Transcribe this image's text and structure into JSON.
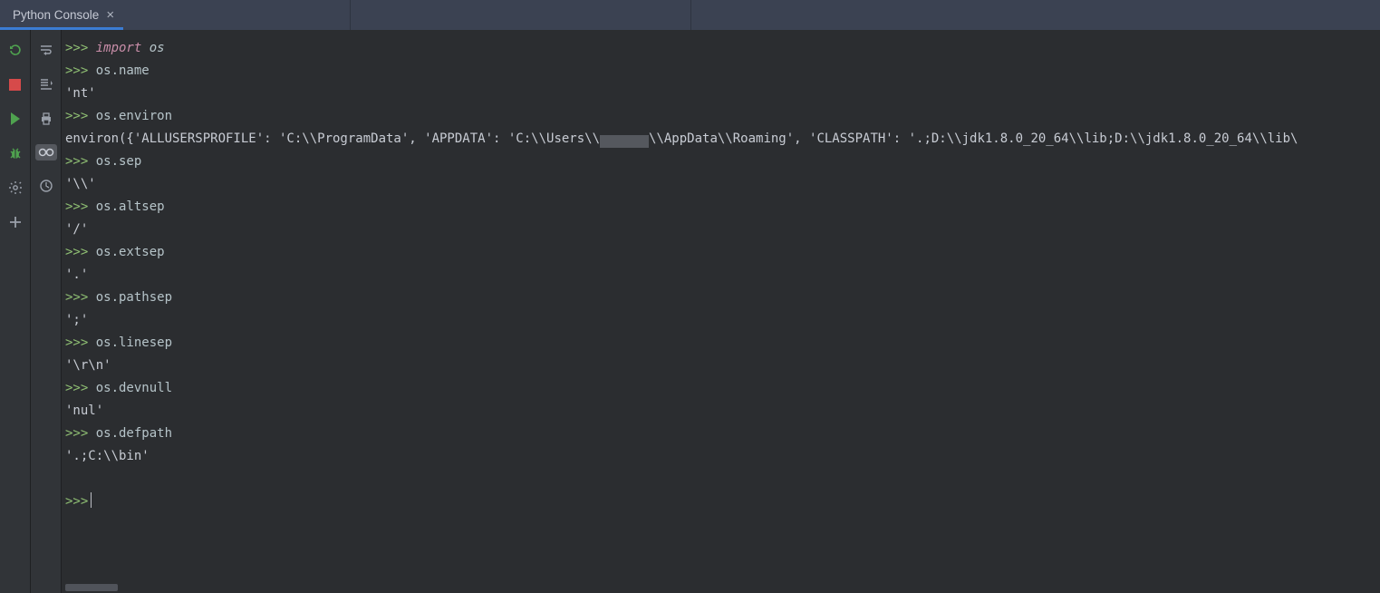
{
  "tab": {
    "title": "Python Console"
  },
  "toolbar_left": {
    "rerun": "rerun-icon",
    "stop": "stop-icon",
    "run": "run-icon",
    "debug": "debug-icon",
    "settings": "settings-icon",
    "add": "add-icon"
  },
  "toolbar_right": {
    "soft_wrap": "soft-wrap-icon",
    "scroll_end": "scroll-to-end-icon",
    "print": "print-icon",
    "show_vars": "show-vars-icon",
    "history": "history-icon"
  },
  "console": {
    "prompt": ">>>",
    "lines": [
      {
        "type": "input",
        "prefix": "import",
        "text": " os"
      },
      {
        "type": "input",
        "text": "os.name"
      },
      {
        "type": "output",
        "text": "'nt'"
      },
      {
        "type": "input",
        "text": "os.environ"
      },
      {
        "type": "output_environ",
        "pre": "environ({'ALLUSERSPROFILE': 'C:\\\\ProgramData', 'APPDATA': 'C:\\\\Users\\\\",
        "mid": "REDACTED",
        "post": "\\\\AppData\\\\Roaming', 'CLASSPATH': '.;D:\\\\jdk1.8.0_20_64\\\\lib;D:\\\\jdk1.8.0_20_64\\\\lib\\"
      },
      {
        "type": "input",
        "text": "os.sep"
      },
      {
        "type": "output",
        "text": "'\\\\'"
      },
      {
        "type": "input",
        "text": "os.altsep"
      },
      {
        "type": "output",
        "text": "'/'"
      },
      {
        "type": "input",
        "text": "os.extsep"
      },
      {
        "type": "output",
        "text": "'.'"
      },
      {
        "type": "input",
        "text": "os.pathsep"
      },
      {
        "type": "output",
        "text": "';'"
      },
      {
        "type": "input",
        "text": "os.linesep"
      },
      {
        "type": "output",
        "text": "'\\r\\n'"
      },
      {
        "type": "input",
        "text": "os.devnull"
      },
      {
        "type": "output",
        "text": "'nul'"
      },
      {
        "type": "input",
        "text": "os.defpath"
      },
      {
        "type": "output",
        "text": "'.;C:\\\\bin'"
      },
      {
        "type": "blank"
      },
      {
        "type": "input_cursor"
      }
    ]
  }
}
